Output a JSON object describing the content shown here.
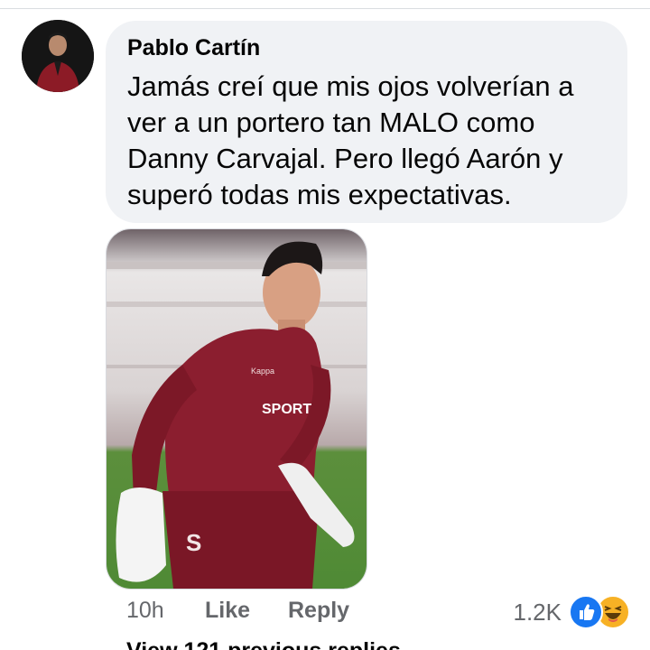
{
  "comment": {
    "author": "Pablo Cartín",
    "text": "Jamás creí que mis ojos volverían a ver a un portero tan MALO como Danny Carvajal. Pero llegó Aarón y superó todas mis expectativas.",
    "photo_jersey_brand": "Kappa",
    "photo_sponsor": "SPORT",
    "photo_number": "S"
  },
  "actions": {
    "time": "10h",
    "like_label": "Like",
    "reply_label": "Reply"
  },
  "reactions": {
    "count": "1.2K",
    "icons": [
      "like-icon",
      "haha-icon"
    ]
  },
  "colors": {
    "bubble": "#f0f2f5",
    "meta_text": "#65676b",
    "like_blue": "#1877f2",
    "haha_yellow": "#f7b125",
    "jersey_maroon": "#8b1e2f"
  }
}
